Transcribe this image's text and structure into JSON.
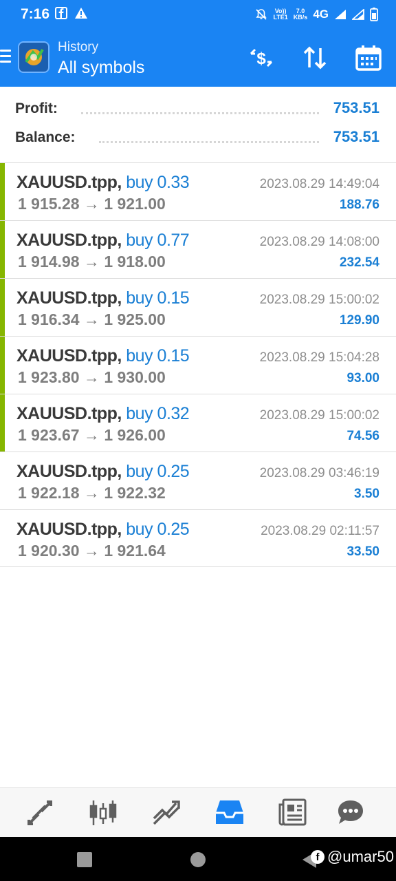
{
  "status_bar": {
    "time": "7:16",
    "net_speed_top": "7.0",
    "net_speed_bottom": "KB/s",
    "volte_top": "Vo))",
    "volte_bottom": "LTE1",
    "network": "4G"
  },
  "header": {
    "subtitle": "History",
    "title": "All symbols"
  },
  "summary": {
    "profit_label": "Profit:",
    "profit_value": "753.51",
    "balance_label": "Balance:",
    "balance_value": "753.51"
  },
  "trades": [
    {
      "symbol": "XAUUSD.tpp,",
      "side": "buy 0.33",
      "open": "1 915.28",
      "close": "1 921.00",
      "time": "2023.08.29 14:49:04",
      "profit": "188.76",
      "marked": true
    },
    {
      "symbol": "XAUUSD.tpp,",
      "side": "buy 0.77",
      "open": "1 914.98",
      "close": "1 918.00",
      "time": "2023.08.29 14:08:00",
      "profit": "232.54",
      "marked": true
    },
    {
      "symbol": "XAUUSD.tpp,",
      "side": "buy 0.15",
      "open": "1 916.34",
      "close": "1 925.00",
      "time": "2023.08.29 15:00:02",
      "profit": "129.90",
      "marked": true
    },
    {
      "symbol": "XAUUSD.tpp,",
      "side": "buy 0.15",
      "open": "1 923.80",
      "close": "1 930.00",
      "time": "2023.08.29 15:04:28",
      "profit": "93.00",
      "marked": true
    },
    {
      "symbol": "XAUUSD.tpp,",
      "side": "buy 0.32",
      "open": "1 923.67",
      "close": "1 926.00",
      "time": "2023.08.29 15:00:02",
      "profit": "74.56",
      "marked": true
    },
    {
      "symbol": "XAUUSD.tpp,",
      "side": "buy 0.25",
      "open": "1 922.18",
      "close": "1 922.32",
      "time": "2023.08.29 03:46:19",
      "profit": "3.50",
      "marked": false
    },
    {
      "symbol": "XAUUSD.tpp,",
      "side": "buy 0.25",
      "open": "1 920.30",
      "close": "1 921.64",
      "time": "2023.08.29 02:11:57",
      "profit": "33.50",
      "marked": false
    }
  ],
  "arrow": "→",
  "bottom_nav": {
    "items": [
      "quotes-icon",
      "chart-icon",
      "trade-icon",
      "history-icon",
      "news-icon",
      "chat-icon"
    ],
    "active": "history-icon"
  },
  "watermark": {
    "text": "@umar50"
  },
  "colors": {
    "header_blue": "#1a84f3",
    "accent_blue": "#1a7fd4",
    "buy_marker_green": "#86b600",
    "nav_icon_gray": "#5f5f5f"
  }
}
